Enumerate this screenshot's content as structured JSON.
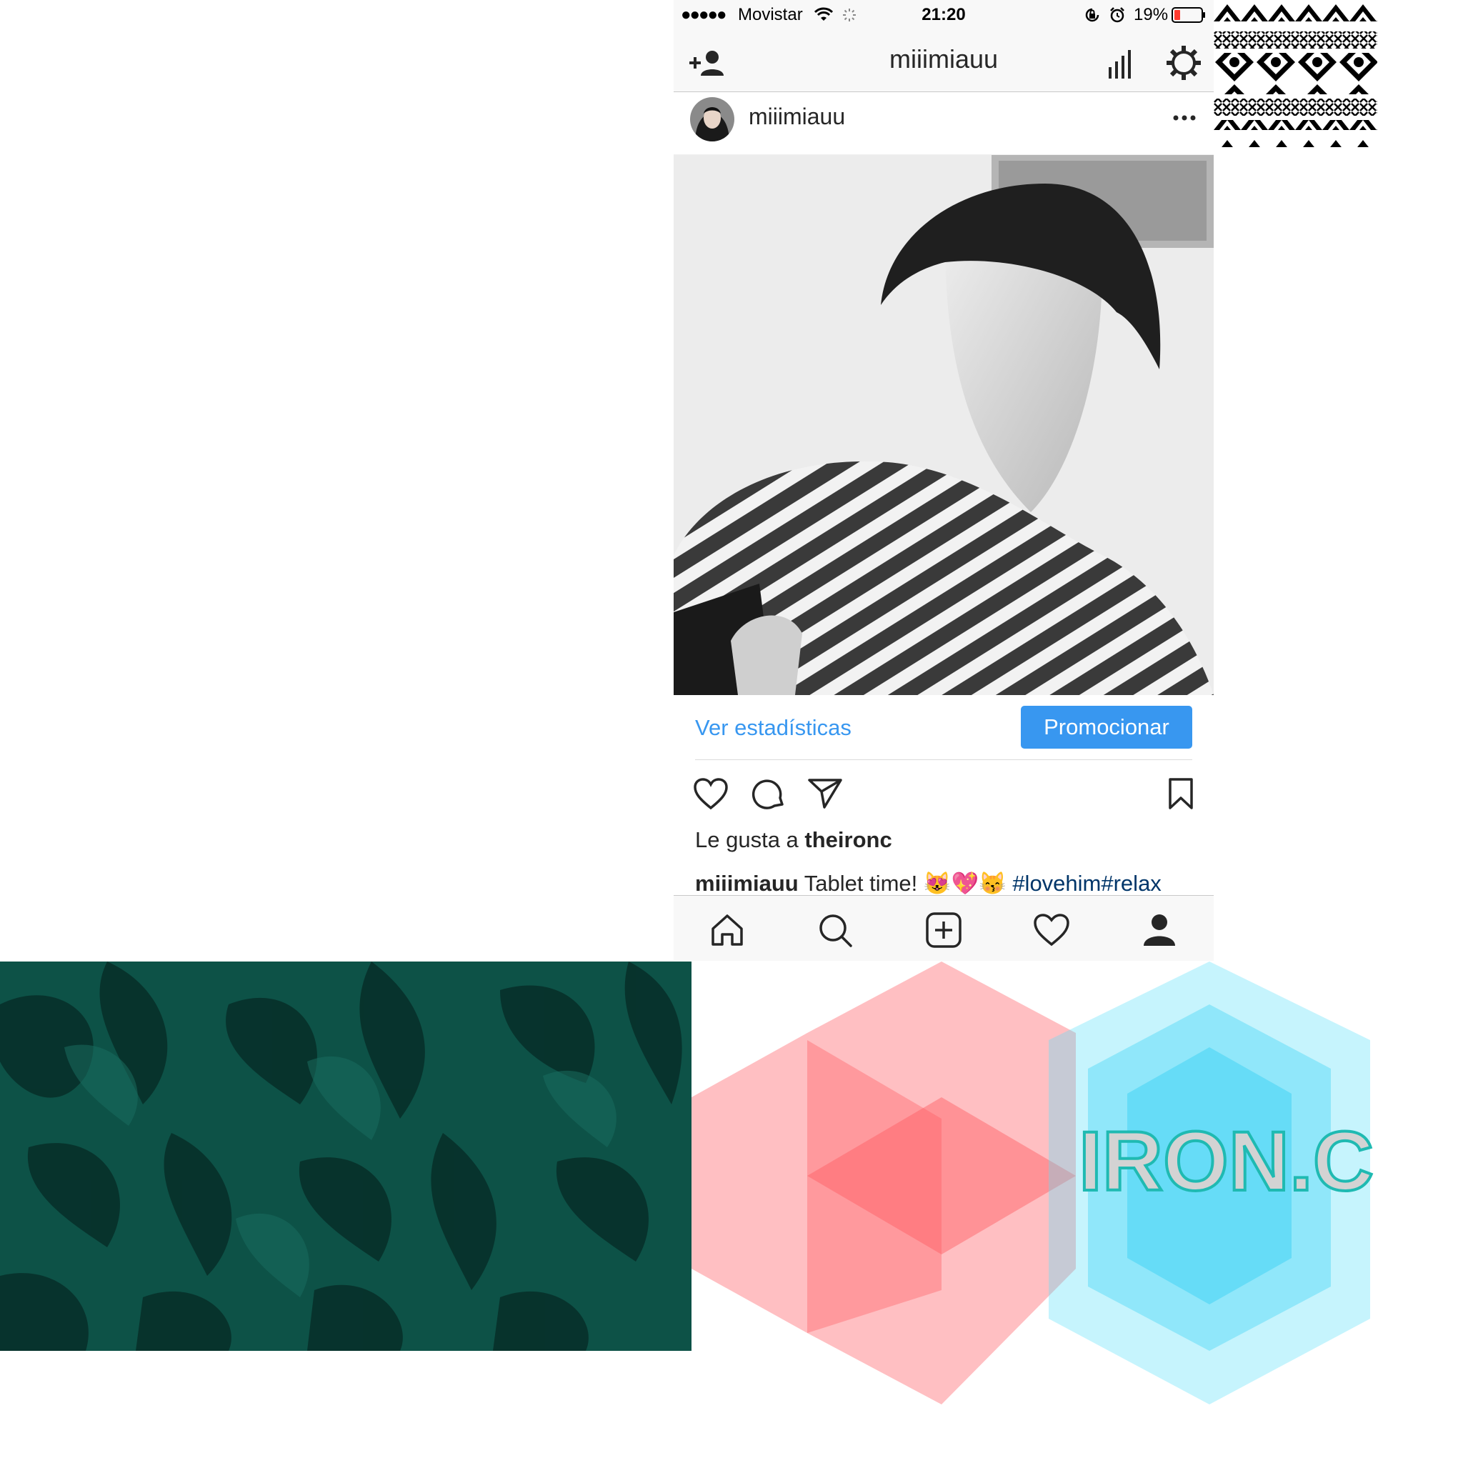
{
  "status_bar": {
    "signal": "●●●●●",
    "carrier": "Movistar",
    "time": "21:20",
    "battery_percent": "19%"
  },
  "nav": {
    "title": "miiimiauu",
    "icons": [
      "add-person-icon",
      "insights-icon",
      "settings-gear-icon"
    ]
  },
  "post": {
    "username": "miiimiauu",
    "view_stats_label": "Ver estadísticas",
    "promote_label": "Promocionar",
    "likes_prefix": "Le gusta a",
    "liked_by": "theironc",
    "caption_user": "miiimiauu",
    "caption_text": "Tablet time! 😻💖😽",
    "caption_hashtags": "#lovehim#relax"
  },
  "tabs": [
    "home-icon",
    "search-icon",
    "new-post-icon",
    "activity-heart-icon",
    "profile-icon"
  ],
  "logo": {
    "text": "IRON.C"
  },
  "colors": {
    "accent": "#3897f0",
    "logo_pink": "#ff8a8f",
    "logo_cyan": "#5ce0fa",
    "teal": "#0b4a40"
  }
}
